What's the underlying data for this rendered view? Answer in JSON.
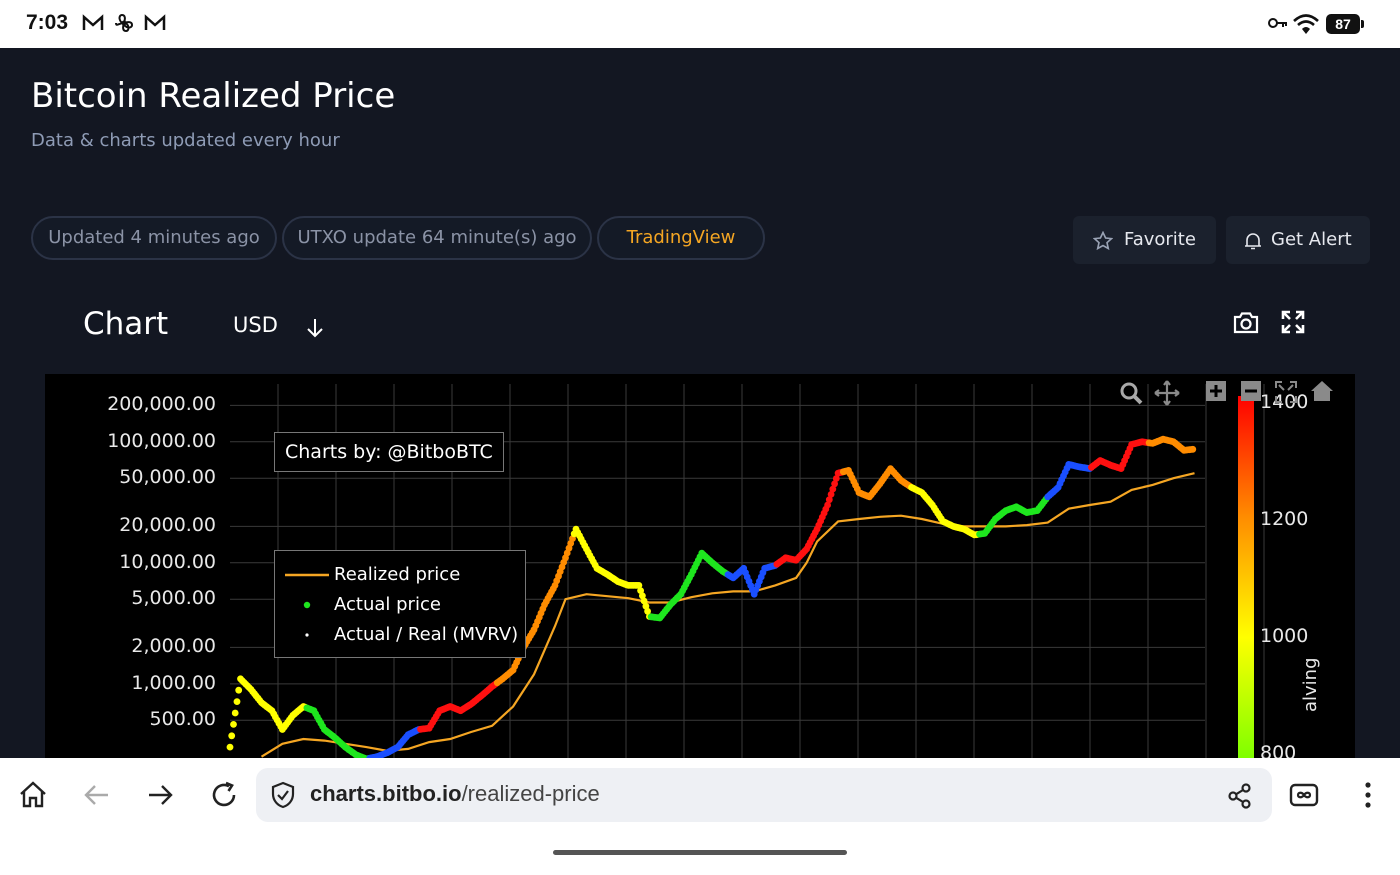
{
  "status_bar": {
    "time": "7:03",
    "battery": "87"
  },
  "page": {
    "title": "Bitcoin Realized Price",
    "subtitle": "Data & charts updated every hour",
    "pills": [
      "Updated 4 minutes ago",
      "UTXO update 64 minute(s) ago",
      "TradingView"
    ],
    "favorite_label": "Favorite",
    "alert_label": "Get Alert",
    "chart_heading": "Chart",
    "currency": "USD"
  },
  "chart_data": {
    "type": "scatter",
    "credit": "Charts by: @BitboBTC",
    "y_scale": "log",
    "y_ticks": [
      "200,000.00",
      "100,000.00",
      "50,000.00",
      "20,000.00",
      "10,000.00",
      "5,000.00",
      "2,000.00",
      "1,000.00",
      "500.00"
    ],
    "colorbar": {
      "ticks": [
        "1400",
        "1200",
        "1000",
        "800"
      ],
      "title_fragment": "alving",
      "range": [
        800,
        1400
      ],
      "colors": [
        "#7fff00",
        "#ffff00",
        "#ff8c00",
        "#ff0000"
      ]
    },
    "legend": [
      {
        "name": "Realized price",
        "color": "#f5a623",
        "marker": "line"
      },
      {
        "name": "Actual price",
        "color": "#1ee61e",
        "marker": "dot"
      },
      {
        "name": "Actual / Real (MVRV)",
        "color": "#ffffff",
        "marker": "small-dot"
      }
    ],
    "series": [
      {
        "name": "Actual price",
        "points": [
          [
            0,
            300
          ],
          [
            1,
            1100
          ],
          [
            2,
            900
          ],
          [
            3,
            700
          ],
          [
            4,
            600
          ],
          [
            5,
            420
          ],
          [
            6,
            550
          ],
          [
            7,
            650
          ],
          [
            8,
            600
          ],
          [
            9,
            420
          ],
          [
            10,
            360
          ],
          [
            11,
            300
          ],
          [
            12,
            260
          ],
          [
            13,
            240
          ],
          [
            14,
            250
          ],
          [
            15,
            270
          ],
          [
            16,
            300
          ],
          [
            17,
            380
          ],
          [
            18,
            420
          ],
          [
            19,
            430
          ],
          [
            20,
            600
          ],
          [
            21,
            650
          ],
          [
            22,
            600
          ],
          [
            23,
            680
          ],
          [
            24,
            800
          ],
          [
            25,
            950
          ],
          [
            26,
            1100
          ],
          [
            27,
            1300
          ],
          [
            28,
            2000
          ],
          [
            29,
            2800
          ],
          [
            30,
            4500
          ],
          [
            31,
            6500
          ],
          [
            32,
            11000
          ],
          [
            33,
            19000
          ],
          [
            34,
            13000
          ],
          [
            35,
            9000
          ],
          [
            36,
            8000
          ],
          [
            37,
            7000
          ],
          [
            38,
            6500
          ],
          [
            39,
            6500
          ],
          [
            40,
            3600
          ],
          [
            41,
            3500
          ],
          [
            42,
            4500
          ],
          [
            43,
            5500
          ],
          [
            44,
            8000
          ],
          [
            45,
            12000
          ],
          [
            46,
            10000
          ],
          [
            47,
            8500
          ],
          [
            48,
            7500
          ],
          [
            49,
            9000
          ],
          [
            50,
            5500
          ],
          [
            51,
            9000
          ],
          [
            52,
            9500
          ],
          [
            53,
            11000
          ],
          [
            54,
            10500
          ],
          [
            55,
            13000
          ],
          [
            56,
            19000
          ],
          [
            57,
            30000
          ],
          [
            58,
            55000
          ],
          [
            59,
            58000
          ],
          [
            60,
            38000
          ],
          [
            61,
            35000
          ],
          [
            62,
            45000
          ],
          [
            63,
            60000
          ],
          [
            64,
            48000
          ],
          [
            65,
            42000
          ],
          [
            66,
            38000
          ],
          [
            67,
            30000
          ],
          [
            68,
            22000
          ],
          [
            69,
            20000
          ],
          [
            70,
            19000
          ],
          [
            71,
            17000
          ],
          [
            72,
            17500
          ],
          [
            73,
            23000
          ],
          [
            74,
            27000
          ],
          [
            75,
            29000
          ],
          [
            76,
            26000
          ],
          [
            77,
            27000
          ],
          [
            78,
            35000
          ],
          [
            79,
            42000
          ],
          [
            80,
            65000
          ],
          [
            81,
            62000
          ],
          [
            82,
            60000
          ],
          [
            83,
            70000
          ],
          [
            84,
            64000
          ],
          [
            85,
            60000
          ],
          [
            86,
            95000
          ],
          [
            87,
            100000
          ],
          [
            88,
            97000
          ],
          [
            89,
            105000
          ],
          [
            90,
            100000
          ],
          [
            91,
            85000
          ],
          [
            92,
            87000
          ]
        ]
      },
      {
        "name": "Realized price",
        "points": [
          [
            3,
            250
          ],
          [
            5,
            320
          ],
          [
            7,
            350
          ],
          [
            9,
            340
          ],
          [
            11,
            320
          ],
          [
            13,
            300
          ],
          [
            15,
            280
          ],
          [
            17,
            290
          ],
          [
            19,
            330
          ],
          [
            21,
            350
          ],
          [
            23,
            400
          ],
          [
            25,
            450
          ],
          [
            27,
            650
          ],
          [
            29,
            1200
          ],
          [
            31,
            3000
          ],
          [
            32,
            5000
          ],
          [
            34,
            5500
          ],
          [
            36,
            5300
          ],
          [
            38,
            5100
          ],
          [
            40,
            4700
          ],
          [
            42,
            4700
          ],
          [
            44,
            5200
          ],
          [
            46,
            5600
          ],
          [
            48,
            5800
          ],
          [
            50,
            5800
          ],
          [
            52,
            6500
          ],
          [
            54,
            7500
          ],
          [
            55,
            10000
          ],
          [
            56,
            15000
          ],
          [
            58,
            22000
          ],
          [
            60,
            23000
          ],
          [
            62,
            24000
          ],
          [
            64,
            24500
          ],
          [
            66,
            23000
          ],
          [
            68,
            21000
          ],
          [
            70,
            20000
          ],
          [
            72,
            20000
          ],
          [
            74,
            20000
          ],
          [
            76,
            20500
          ],
          [
            78,
            21500
          ],
          [
            80,
            28000
          ],
          [
            82,
            30000
          ],
          [
            84,
            32000
          ],
          [
            86,
            40000
          ],
          [
            88,
            44000
          ],
          [
            90,
            50000
          ],
          [
            92,
            55000
          ]
        ]
      }
    ],
    "x_range": [
      0,
      93
    ],
    "y_range": [
      180,
      300000
    ]
  },
  "browser": {
    "url_host": "charts.bitbo.io",
    "url_path": "/realized-price"
  },
  "colors": {
    "accent": "#f5a623",
    "background": "#131722",
    "pill_border": "#2b3346"
  },
  "icons": [
    "mail-icon",
    "fan-icon",
    "key-icon",
    "wifi-icon",
    "star-icon",
    "bell-icon",
    "camera-icon",
    "fullscreen-icon",
    "zoom-icon",
    "pan-icon",
    "plus-icon",
    "minus-icon",
    "autoscale-icon",
    "home-icon",
    "share-icon",
    "tab-switcher-icon",
    "menu-icon",
    "shield-icon",
    "back-icon",
    "forward-icon",
    "reload-icon"
  ]
}
